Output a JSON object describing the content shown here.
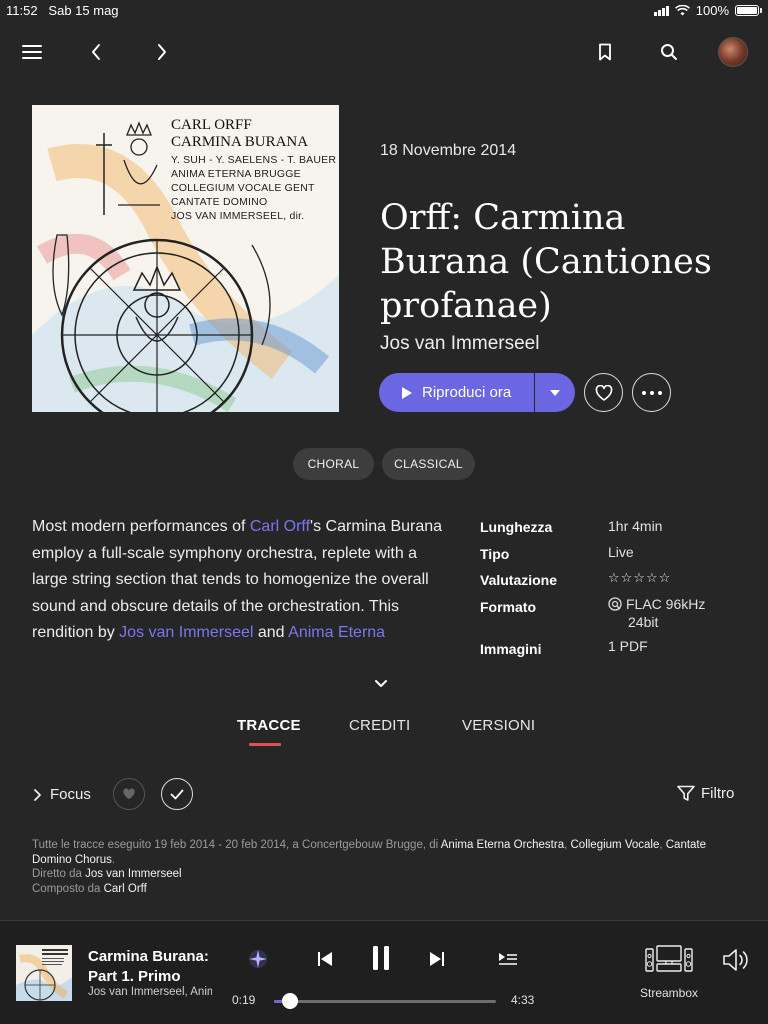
{
  "status_bar": {
    "time": "11:52",
    "date": "Sab 15 mag",
    "battery": "100%"
  },
  "nav": {
    "menu_icon": "hamburger-icon",
    "back_icon": "chevron-left-icon",
    "forward_icon": "chevron-right-icon",
    "bookmark_icon": "bookmark-icon",
    "search_icon": "search-icon"
  },
  "cover": {
    "title_line1": "CARL ORFF",
    "title_line2": "CARMINA BURANA",
    "lines": [
      "Y. SUH - Y. SAELENS - T. BAUER",
      "ANIMA ETERNA BRUGGE",
      "COLLEGIUM VOCALE GENT",
      "CANTATE DOMINO",
      "JOS VAN IMMERSEEL, dir."
    ]
  },
  "album": {
    "date": "18 Novembre 2014",
    "title": "Orff: Carmina Burana (Cantiones profanae)",
    "artist": "Jos van Immerseel"
  },
  "actions": {
    "play_label": "Riproduci ora",
    "accent": "#6b66e2"
  },
  "tags": [
    "CHORAL",
    "CLASSICAL"
  ],
  "description": {
    "t1": "Most modern performances of ",
    "link1": "Carl Orff",
    "t2": "'s Carmina Burana employ a full-scale symphony orchestra, replete with a large string section that tends to homogenize the overall sound and obscure details of the orchestration. This rendition by ",
    "link2": "Jos van Immerseel",
    "t3": " and ",
    "link3": "Anima Eterna"
  },
  "info": {
    "length_label": "Lunghezza",
    "length_value": "1hr 4min",
    "type_label": "Tipo",
    "type_value": "Live",
    "rating_label": "Valutazione",
    "rating_value": "☆☆☆☆☆",
    "format_label": "Formato",
    "format_value_1": "FLAC 96kHz",
    "format_value_2": "24bit",
    "images_label": "Immagini",
    "images_value": "1 PDF"
  },
  "tabs": {
    "tracks": "TRACCE",
    "credits": "CREDITI",
    "versions": "VERSIONI"
  },
  "track_toolbar": {
    "focus": "Focus",
    "filter": "Filtro"
  },
  "credits": {
    "line1_a": "Tutte le tracce eseguito 19 feb 2014 - 20 feb 2014, a Concertgebouw Brugge, di ",
    "line1_b": "Anima Eterna Orchestra",
    "line1_c": ", ",
    "line1_d": "Collegium Vocale",
    "line1_e": ", ",
    "line1_f": "Cantate Domino Chorus",
    "line1_g": ".",
    "directed_label": "Diretto da ",
    "directed_value": "Jos van Immerseel",
    "composed_label": "Composto da ",
    "composed_value": "Carl Orff"
  },
  "player": {
    "title": "Carmina Burana: Part 1. Primo",
    "artist": "Jos van Immerseel, Anima Eterna",
    "elapsed": "0:19",
    "duration": "4:33",
    "progress": 0.07,
    "device": "Streambox"
  }
}
